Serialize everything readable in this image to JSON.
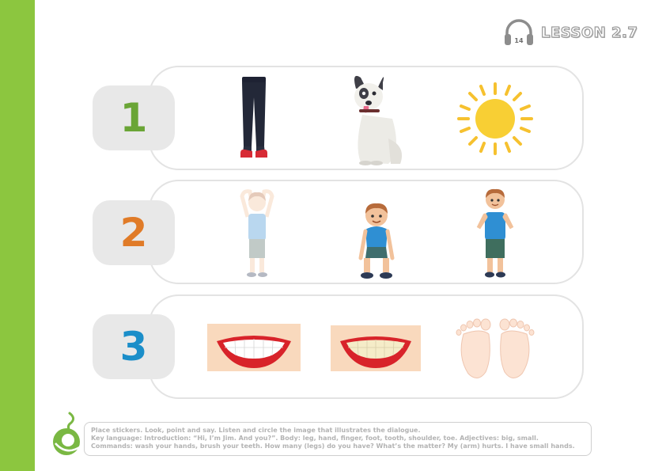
{
  "header": {
    "track_number": "14",
    "lesson": "LESSON 2.7"
  },
  "rows": [
    {
      "number": "1",
      "number_color": "#6aa536",
      "items": [
        "trousers-shoes",
        "dog",
        "sun"
      ]
    },
    {
      "number": "2",
      "number_color": "#e07b28",
      "items": [
        "boy-hands-on-head",
        "boy-touching-knees",
        "boy-touching-shoulders"
      ]
    },
    {
      "number": "3",
      "number_color": "#1b8ec9",
      "items": [
        "smile-white-teeth",
        "smile-yellow-teeth",
        "feet"
      ]
    }
  ],
  "info": {
    "line1": "Place stickers. Look, point and say. Listen and circle the image that illustrates the dialogue.",
    "line2": "Key language: Introduction: “Hi, I’m Jim. And you?”. Body: leg, hand, finger, foot, tooth, shoulder, toe. Adjectives: big, small.",
    "line3": "Commands: wash your hands, brush your teeth. How many (legs) do you have? What’s the matter? My (arm) hurts. I have small hands."
  },
  "colors": {
    "accent_green": "#8cc63f",
    "pill_border": "#e3e3e3",
    "number_box": "#e8e8e8"
  }
}
